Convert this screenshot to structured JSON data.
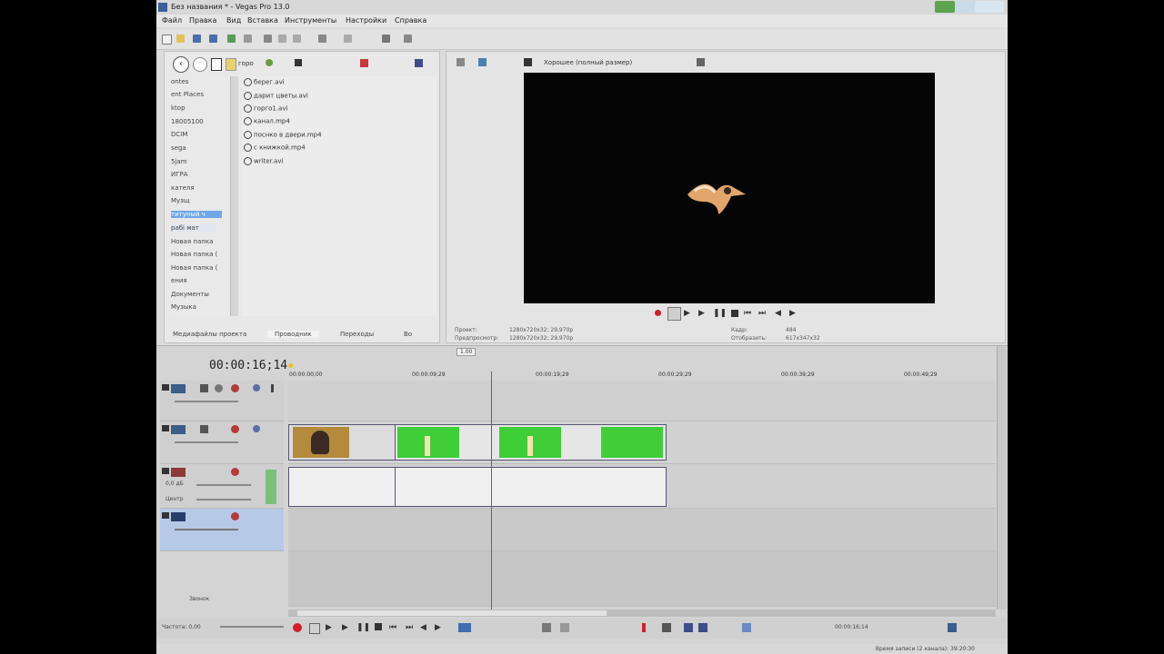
{
  "window": {
    "title": "Без названия * - Vegas Pro 13.0"
  },
  "menu": [
    "Файл",
    "Правка",
    "Вид",
    "Вставка",
    "Инструменты",
    "Настройки",
    "Справка"
  ],
  "explorer": {
    "path": "горо",
    "folders": [
      "ontes",
      "ent Places",
      "ktop",
      "18005100",
      "DCIM",
      "sega",
      "5jam",
      "ИГРА",
      "кателя",
      "Музщ",
      "титуный ч",
      "рабі мат",
      "Новая папка",
      "Новая папка (",
      "Новая папка (",
      "ения",
      "Документы",
      "Музыка"
    ],
    "selected_folders": [
      10,
      11
    ],
    "files": [
      "берег.avi",
      "дарит цветы.avi",
      "горго1.avi",
      "канал.mp4",
      "поснко в двери.mp4",
      "с книжкой.mp4",
      "writer.avi"
    ]
  },
  "bottom_tabs": [
    "Медиафайлы проекта",
    "Проводник",
    "Переходы",
    "Во"
  ],
  "preview": {
    "quality": "Хорошее (полный размер)",
    "info_labels": [
      "Проект:",
      "Предпросмотр:"
    ],
    "info_values": [
      "1280x720x32; 29,970p",
      "1280x720x32; 29,970p"
    ],
    "frame_labels": [
      "Кадр:",
      "Отобразить:"
    ],
    "frame_values": [
      "484",
      "617x347x32"
    ]
  },
  "timeline": {
    "timecode": "00:00:16;14",
    "rate_label": "1.00",
    "ruler": [
      "00:00:00;00",
      "00:00:09;29",
      "00:00:19;29",
      "00:00:29;29",
      "00:00:39;29",
      "00:00:49;29"
    ],
    "audio_track": {
      "volume": "0,0 дБ",
      "pan": "Центр"
    },
    "master_label": "Звонок"
  },
  "transport": {
    "rate": "Частота: 0,00",
    "end_time": "00:00:16;14"
  },
  "status": {
    "record_time": "Время записи (2 канала): 39:20:30"
  },
  "colors": {
    "green_screen": "#3fce38",
    "clip_border": "#5555aa",
    "record_red": "#d0202a"
  }
}
